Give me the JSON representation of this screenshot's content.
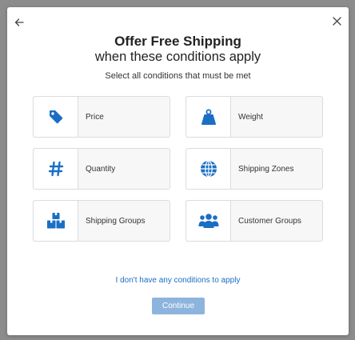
{
  "modal": {
    "title": "Offer Free Shipping",
    "subtitle": "when these conditions apply",
    "instruction": "Select all conditions that must be met",
    "no_conditions_link": "I don't have any conditions to apply",
    "continue_label": "Continue"
  },
  "conditions": [
    {
      "label": "Price",
      "icon": "price-tag-icon"
    },
    {
      "label": "Weight",
      "icon": "weight-icon"
    },
    {
      "label": "Quantity",
      "icon": "hash-icon"
    },
    {
      "label": "Shipping Zones",
      "icon": "globe-icon"
    },
    {
      "label": "Shipping Groups",
      "icon": "boxes-icon"
    },
    {
      "label": "Customer Groups",
      "icon": "users-icon"
    }
  ],
  "colors": {
    "accent": "#1a6fc4",
    "icon": "#1a6fc4",
    "continue_disabled": "#8db4dd"
  }
}
